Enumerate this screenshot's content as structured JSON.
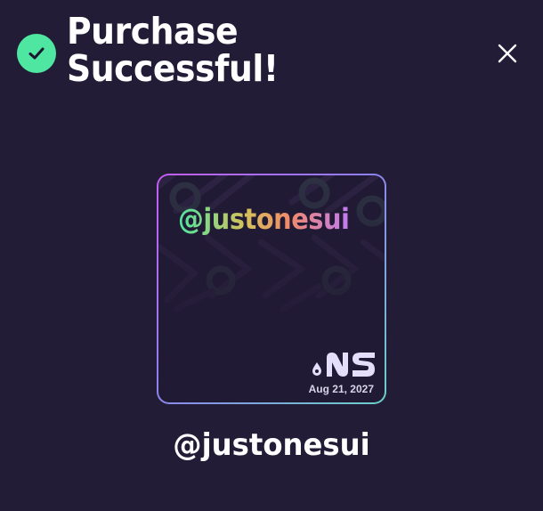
{
  "header": {
    "title_line1": "Purchase",
    "title_line2": "Successful!",
    "status_icon": "checkmark-circle-icon",
    "close_icon": "close-icon"
  },
  "card": {
    "handle": "@justonesui",
    "logo_text": ".NS",
    "expiry": "Aug 21, 2027"
  },
  "name_label": "@justonesui",
  "colors": {
    "background": "#221c36",
    "success": "#4ee6a0",
    "card_border_start": "#c45cf5",
    "card_border_end": "#6ad1c8"
  }
}
